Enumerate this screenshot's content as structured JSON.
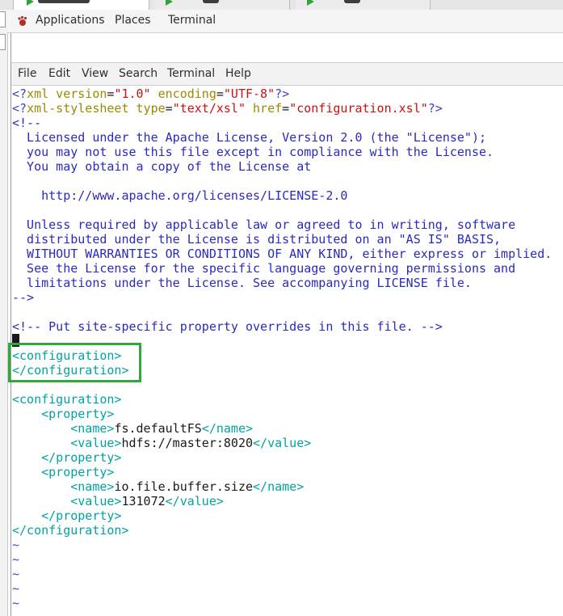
{
  "panel": {
    "applications": "Applications",
    "places": "Places",
    "terminal": "Terminal"
  },
  "menubar": [
    "File",
    "Edit",
    "View",
    "Search",
    "Terminal",
    "Help"
  ],
  "file": {
    "l1": [
      "<?",
      "xml version",
      "=",
      "\"1.0\"",
      " encoding",
      "=",
      "\"UTF-8\"",
      "?>"
    ],
    "l2": [
      "<?",
      "xml-stylesheet type",
      "=",
      "\"text/xsl\"",
      " href",
      "=",
      "\"configuration.xsl\"",
      "?>"
    ],
    "comment": [
      "<!--",
      "  Licensed under the Apache License, Version 2.0 (the \"License\");",
      "  you may not use this file except in compliance with the License.",
      "  You may obtain a copy of the License at",
      "",
      "    http://www.apache.org/licenses/LICENSE-2.0",
      "",
      "  Unless required by applicable law or agreed to in writing, software",
      "  distributed under the License is distributed on an \"AS IS\" BASIS,",
      "  WITHOUT WARRANTIES OR CONDITIONS OF ANY KIND, either express or implied.",
      "  See the License for the specific language governing permissions and",
      "  limitations under the License. See accompanying LICENSE file.",
      "-->"
    ],
    "site_comment": "<!-- Put site-specific property overrides in this file. -->",
    "empty_config_open": "<configuration>",
    "empty_config_close": "</configuration>",
    "config_open": "<configuration>",
    "prop1_open": "    <property>",
    "prop1_name_open": "        <name>",
    "prop1_name": "fs.defaultFS",
    "prop1_name_close": "</name>",
    "prop1_value_open": "        <value>",
    "prop1_value": "hdfs://master:8020",
    "prop1_value_close": "</value>",
    "prop1_close": "    </property>",
    "prop2_open": "    <property>",
    "prop2_name_open": "        <name>",
    "prop2_name": "io.file.buffer.size",
    "prop2_name_close": "</name>",
    "prop2_value_open": "        <value>",
    "prop2_value": "131072",
    "prop2_value_close": "</value>",
    "prop2_close": "    </property>",
    "config_close": "</configuration>",
    "tilde": "~"
  },
  "colors": {
    "highlight_box": "#2eaa3c",
    "tag": "#00a3a3"
  }
}
